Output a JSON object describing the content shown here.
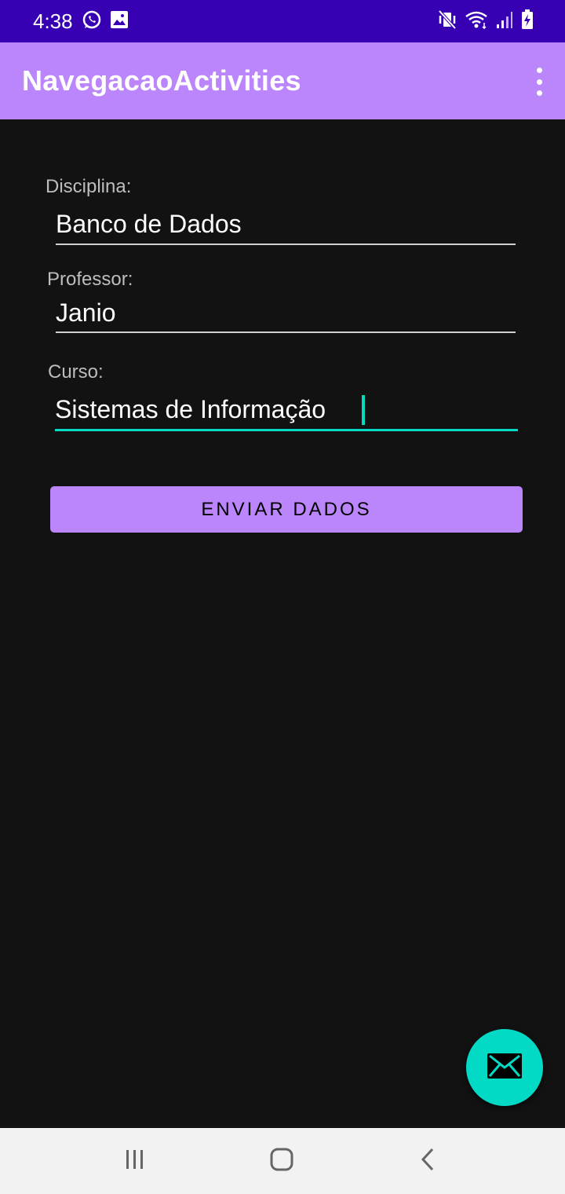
{
  "status_bar": {
    "time": "4:38",
    "left_icons": [
      "whatsapp-icon",
      "image-icon"
    ],
    "right_icons": [
      "mute-vibrate-icon",
      "wifi-icon",
      "signal-icon",
      "battery-charging-icon"
    ]
  },
  "app_bar": {
    "title": "NavegacaoActivities",
    "menu_icon": "more-vert-icon"
  },
  "form": {
    "disciplina": {
      "label": "Disciplina:",
      "value": "Banco de Dados"
    },
    "professor": {
      "label": "Professor:",
      "value": "Janio"
    },
    "curso": {
      "label": "Curso:",
      "value": "Sistemas de Informação"
    },
    "submit_label": "ENVIAR DADOS"
  },
  "fab": {
    "icon": "mail-icon"
  },
  "nav_bar": {
    "buttons": [
      "recents-icon",
      "home-icon",
      "back-icon"
    ]
  },
  "colors": {
    "primary": "#bb86fc",
    "primary_dark": "#3700b3",
    "accent": "#03dac5",
    "background": "#121212"
  }
}
